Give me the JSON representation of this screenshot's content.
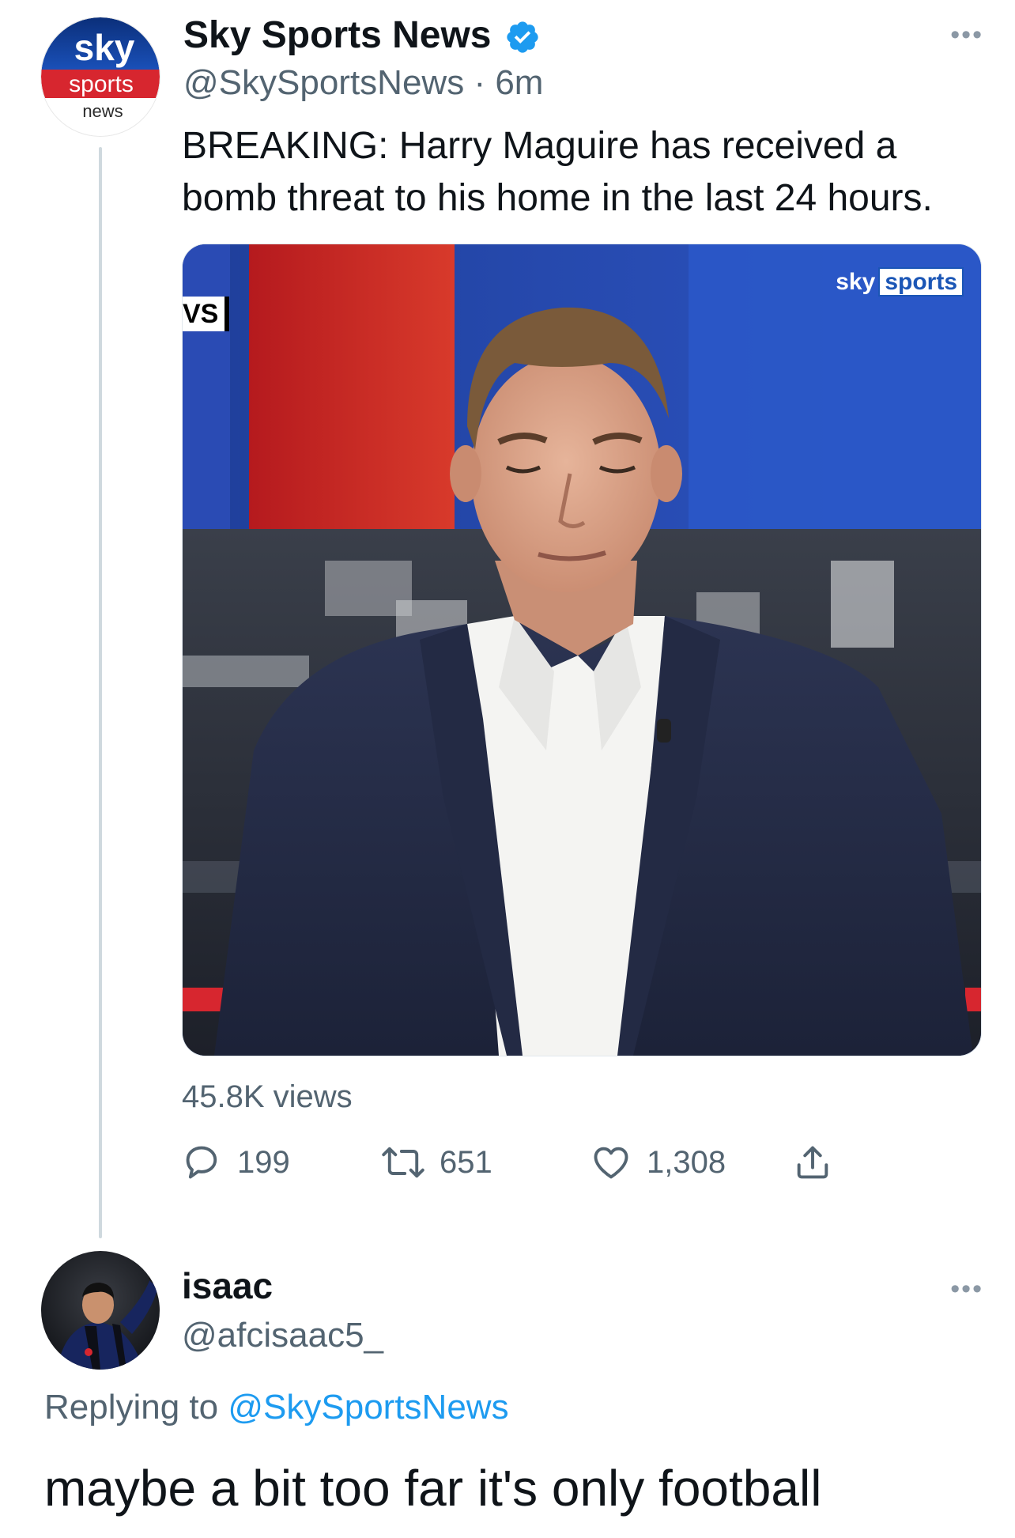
{
  "tweet": {
    "author_name": "Sky Sports News",
    "handle": "@SkySportsNews",
    "separator": "·",
    "time": "6m",
    "text": "BREAKING: Harry Maguire has received a bomb threat to his home in the last 24 hours.",
    "avatar": {
      "line1": "sky",
      "line2": "sports",
      "line3": "news"
    },
    "media": {
      "corner_tag": "VS",
      "watermark_sky": "sky",
      "watermark_sports": "sports"
    },
    "views": "45.8K views",
    "actions": {
      "replies": "199",
      "retweets": "651",
      "likes": "1,308"
    },
    "more_icon": "more-horizontal-icon"
  },
  "reply": {
    "name": "isaac",
    "handle": "@afcisaac5_",
    "replying_prefix": "Replying to",
    "replying_to": "@SkySportsNews",
    "text": "maybe a bit too far it's only football"
  },
  "colors": {
    "text": "#0f1419",
    "muted": "#536471",
    "link": "#1d9bf0",
    "verified": "#1d9bf0",
    "sky_red": "#d7262f",
    "sky_blue": "#1b56b6"
  }
}
